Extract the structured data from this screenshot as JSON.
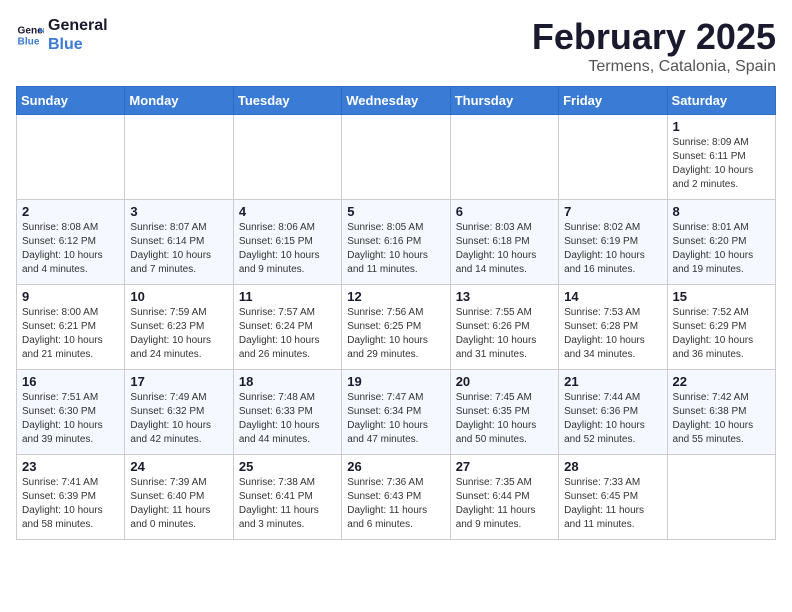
{
  "logo": {
    "line1": "General",
    "line2": "Blue"
  },
  "title": "February 2025",
  "location": "Termens, Catalonia, Spain",
  "days_header": [
    "Sunday",
    "Monday",
    "Tuesday",
    "Wednesday",
    "Thursday",
    "Friday",
    "Saturday"
  ],
  "weeks": [
    [
      {
        "day": "",
        "info": ""
      },
      {
        "day": "",
        "info": ""
      },
      {
        "day": "",
        "info": ""
      },
      {
        "day": "",
        "info": ""
      },
      {
        "day": "",
        "info": ""
      },
      {
        "day": "",
        "info": ""
      },
      {
        "day": "1",
        "info": "Sunrise: 8:09 AM\nSunset: 6:11 PM\nDaylight: 10 hours and 2 minutes."
      }
    ],
    [
      {
        "day": "2",
        "info": "Sunrise: 8:08 AM\nSunset: 6:12 PM\nDaylight: 10 hours and 4 minutes."
      },
      {
        "day": "3",
        "info": "Sunrise: 8:07 AM\nSunset: 6:14 PM\nDaylight: 10 hours and 7 minutes."
      },
      {
        "day": "4",
        "info": "Sunrise: 8:06 AM\nSunset: 6:15 PM\nDaylight: 10 hours and 9 minutes."
      },
      {
        "day": "5",
        "info": "Sunrise: 8:05 AM\nSunset: 6:16 PM\nDaylight: 10 hours and 11 minutes."
      },
      {
        "day": "6",
        "info": "Sunrise: 8:03 AM\nSunset: 6:18 PM\nDaylight: 10 hours and 14 minutes."
      },
      {
        "day": "7",
        "info": "Sunrise: 8:02 AM\nSunset: 6:19 PM\nDaylight: 10 hours and 16 minutes."
      },
      {
        "day": "8",
        "info": "Sunrise: 8:01 AM\nSunset: 6:20 PM\nDaylight: 10 hours and 19 minutes."
      }
    ],
    [
      {
        "day": "9",
        "info": "Sunrise: 8:00 AM\nSunset: 6:21 PM\nDaylight: 10 hours and 21 minutes."
      },
      {
        "day": "10",
        "info": "Sunrise: 7:59 AM\nSunset: 6:23 PM\nDaylight: 10 hours and 24 minutes."
      },
      {
        "day": "11",
        "info": "Sunrise: 7:57 AM\nSunset: 6:24 PM\nDaylight: 10 hours and 26 minutes."
      },
      {
        "day": "12",
        "info": "Sunrise: 7:56 AM\nSunset: 6:25 PM\nDaylight: 10 hours and 29 minutes."
      },
      {
        "day": "13",
        "info": "Sunrise: 7:55 AM\nSunset: 6:26 PM\nDaylight: 10 hours and 31 minutes."
      },
      {
        "day": "14",
        "info": "Sunrise: 7:53 AM\nSunset: 6:28 PM\nDaylight: 10 hours and 34 minutes."
      },
      {
        "day": "15",
        "info": "Sunrise: 7:52 AM\nSunset: 6:29 PM\nDaylight: 10 hours and 36 minutes."
      }
    ],
    [
      {
        "day": "16",
        "info": "Sunrise: 7:51 AM\nSunset: 6:30 PM\nDaylight: 10 hours and 39 minutes."
      },
      {
        "day": "17",
        "info": "Sunrise: 7:49 AM\nSunset: 6:32 PM\nDaylight: 10 hours and 42 minutes."
      },
      {
        "day": "18",
        "info": "Sunrise: 7:48 AM\nSunset: 6:33 PM\nDaylight: 10 hours and 44 minutes."
      },
      {
        "day": "19",
        "info": "Sunrise: 7:47 AM\nSunset: 6:34 PM\nDaylight: 10 hours and 47 minutes."
      },
      {
        "day": "20",
        "info": "Sunrise: 7:45 AM\nSunset: 6:35 PM\nDaylight: 10 hours and 50 minutes."
      },
      {
        "day": "21",
        "info": "Sunrise: 7:44 AM\nSunset: 6:36 PM\nDaylight: 10 hours and 52 minutes."
      },
      {
        "day": "22",
        "info": "Sunrise: 7:42 AM\nSunset: 6:38 PM\nDaylight: 10 hours and 55 minutes."
      }
    ],
    [
      {
        "day": "23",
        "info": "Sunrise: 7:41 AM\nSunset: 6:39 PM\nDaylight: 10 hours and 58 minutes."
      },
      {
        "day": "24",
        "info": "Sunrise: 7:39 AM\nSunset: 6:40 PM\nDaylight: 11 hours and 0 minutes."
      },
      {
        "day": "25",
        "info": "Sunrise: 7:38 AM\nSunset: 6:41 PM\nDaylight: 11 hours and 3 minutes."
      },
      {
        "day": "26",
        "info": "Sunrise: 7:36 AM\nSunset: 6:43 PM\nDaylight: 11 hours and 6 minutes."
      },
      {
        "day": "27",
        "info": "Sunrise: 7:35 AM\nSunset: 6:44 PM\nDaylight: 11 hours and 9 minutes."
      },
      {
        "day": "28",
        "info": "Sunrise: 7:33 AM\nSunset: 6:45 PM\nDaylight: 11 hours and 11 minutes."
      },
      {
        "day": "",
        "info": ""
      }
    ]
  ]
}
